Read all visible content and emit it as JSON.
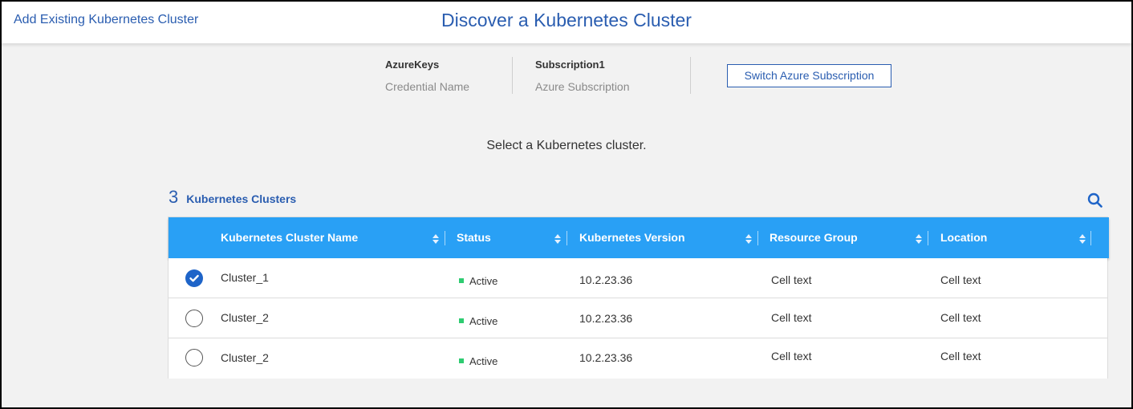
{
  "header": {
    "back_link": "Add Existing Kubernetes Cluster",
    "title": "Discover a Kubernetes Cluster"
  },
  "credentials": {
    "credential_value": "AzureKeys",
    "credential_label": "Credential Name",
    "subscription_value": "Subscription1",
    "subscription_label": "Azure Subscription",
    "switch_button": "Switch Azure Subscription"
  },
  "instruction": "Select a Kubernetes cluster.",
  "clusters_summary": {
    "count": "3",
    "label": "Kubernetes Clusters"
  },
  "table": {
    "columns": [
      "Kubernetes Cluster Name",
      "Status",
      "Kubernetes Version",
      "Resource Group",
      "Location"
    ],
    "rows": [
      {
        "selected": true,
        "name": "Cluster_1",
        "status": "Active",
        "version": "10.2.23.36",
        "resource_group": "Cell text",
        "location": "Cell text"
      },
      {
        "selected": false,
        "name": "Cluster_2",
        "status": "Active",
        "version": "10.2.23.36",
        "resource_group": "Cell text",
        "location": "Cell text"
      },
      {
        "selected": false,
        "name": "Cluster_2",
        "status": "Active",
        "version": "10.2.23.36",
        "resource_group": "Cell text",
        "location": "Cell text"
      }
    ]
  },
  "colors": {
    "accent": "#2a5db0",
    "header_bg": "#29a0f5",
    "status_active": "#2ecc71"
  },
  "icons": [
    "search-icon",
    "sort-icon",
    "check-icon"
  ]
}
